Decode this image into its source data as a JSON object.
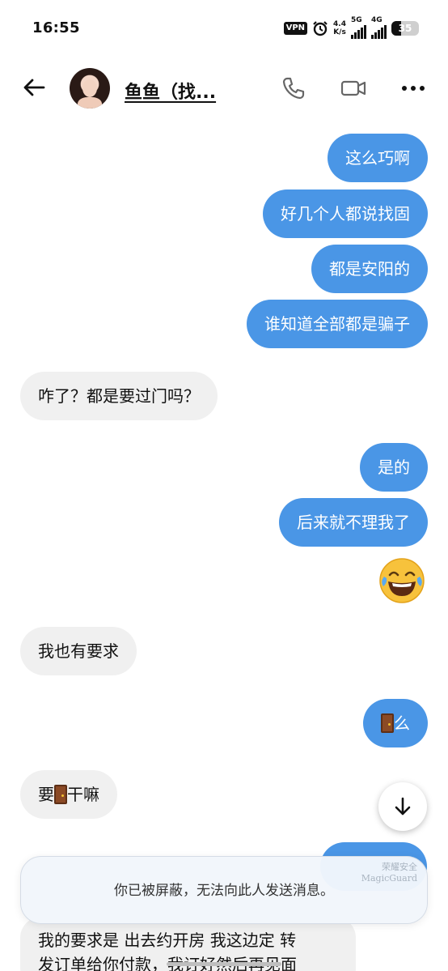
{
  "status_bar": {
    "time": "16:55",
    "vpn": "VPN",
    "speed_value": "4.4",
    "speed_unit": "K/s",
    "signal1_label": "5G",
    "signal2_label": "4G",
    "battery": "35",
    "battery_level": 0.35
  },
  "header": {
    "contact_name": "鱼鱼（找..."
  },
  "messages": {
    "m1": "这么巧啊",
    "m2": "好几个人都说找固",
    "m3": "都是安阳的",
    "m4": "谁知道全部都是骗子",
    "m5": "咋了？都是要过门吗？",
    "m6": "是的",
    "m7": "后来就不理我了",
    "m8": "我也有要求",
    "m9_text": "么",
    "m10_pre": "要",
    "m10_post": "干嘛",
    "m11_line1": "我的要求是 出去约开房 我这边定 转",
    "m11_line2": "发订单给你付款，我订好然后再见面"
  },
  "blocked_notice": "你已被屏蔽，无法向此人发送消息。",
  "watermark": {
    "line1": "荣耀安全",
    "line2": "MagicGuard"
  },
  "colors": {
    "outgoing_bubble": "#4a96e6",
    "incoming_bubble": "#f0f0f0"
  },
  "icons": [
    "back-arrow-icon",
    "phone-icon",
    "video-icon",
    "more-icon",
    "laughing-emoji-icon",
    "door-icon",
    "arrow-down-icon",
    "alarm-icon"
  ]
}
